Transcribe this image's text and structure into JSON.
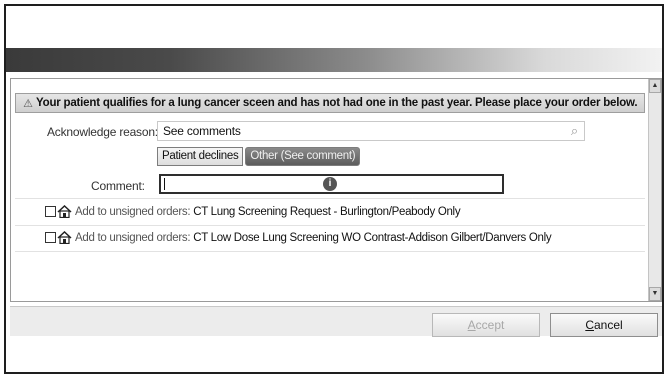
{
  "alert": {
    "message": "Your patient qualifies for a lung cancer sceen and has not had one in the past year. Please place your order below."
  },
  "acknowledge": {
    "label": "Acknowledge reason:",
    "value": "See comments",
    "options": [
      {
        "label": "Patient declines",
        "selected": false
      },
      {
        "label": "Other (See comment)",
        "selected": true
      }
    ]
  },
  "comment": {
    "label": "Comment:",
    "value": ""
  },
  "orders": [
    {
      "prefix": "Add to unsigned orders:",
      "name": "CT Lung Screening Request - Burlington/Peabody Only"
    },
    {
      "prefix": "Add to unsigned orders:",
      "name": "CT Low Dose Lung Screening WO Contrast-Addison Gilbert/Danvers Only"
    }
  ],
  "footer": {
    "accept_first": "A",
    "accept_rest": "ccept",
    "cancel_first": "C",
    "cancel_rest": "ancel"
  }
}
